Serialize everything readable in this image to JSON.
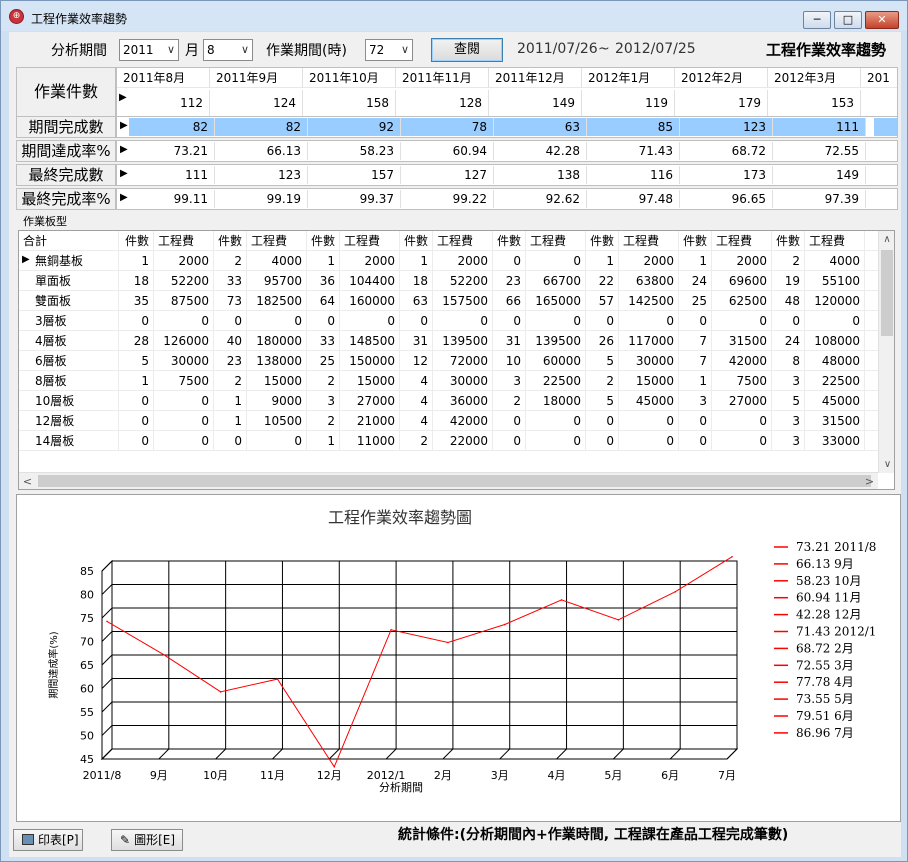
{
  "window": {
    "title": "工程作業效率趨勢",
    "minimize": "─",
    "maximize": "□",
    "close": "✕"
  },
  "filter": {
    "period_label": "分析期間",
    "year": "2011",
    "month_label": "月",
    "month": "8",
    "hours_label": "作業期間(時)",
    "hours": "72",
    "query_button": "查閱",
    "date_from": "2011/07/26",
    "date_sep": "~",
    "date_to": "2012/07/25",
    "report_title": "工程作業效率趨勢"
  },
  "summary": {
    "months": [
      "2011年8月",
      "2011年9月",
      "2011年10月",
      "2011年11月",
      "2011年12月",
      "2012年1月",
      "2012年2月",
      "2012年3月",
      "201"
    ],
    "rows": [
      {
        "label": "作業件數",
        "values": [
          "112",
          "124",
          "158",
          "128",
          "149",
          "119",
          "179",
          "153"
        ]
      },
      {
        "label": "期間完成數",
        "values": [
          "82",
          "82",
          "92",
          "78",
          "63",
          "85",
          "123",
          "111"
        ]
      },
      {
        "label": "期間達成率%",
        "values": [
          "73.21",
          "66.13",
          "58.23",
          "60.94",
          "42.28",
          "71.43",
          "68.72",
          "72.55"
        ]
      },
      {
        "label": "最終完成數",
        "values": [
          "111",
          "123",
          "157",
          "127",
          "138",
          "116",
          "173",
          "149"
        ]
      },
      {
        "label": "最終完成率%",
        "values": [
          "99.11",
          "99.19",
          "99.37",
          "99.22",
          "92.62",
          "97.48",
          "96.65",
          "97.39"
        ]
      }
    ],
    "section_label": "作業板型"
  },
  "detail": {
    "headers": [
      "合計",
      "件數",
      "工程費",
      "件數",
      "工程費",
      "件數",
      "工程費",
      "件數",
      "工程費",
      "件數",
      "工程費",
      "件數",
      "工程費",
      "件數",
      "工程費",
      "件數",
      "工程費"
    ],
    "rows": [
      [
        "無銅基板",
        "1",
        "2000",
        "2",
        "4000",
        "1",
        "2000",
        "1",
        "2000",
        "0",
        "0",
        "1",
        "2000",
        "1",
        "2000",
        "2",
        "4000"
      ],
      [
        "單面板",
        "18",
        "52200",
        "33",
        "95700",
        "36",
        "104400",
        "18",
        "52200",
        "23",
        "66700",
        "22",
        "63800",
        "24",
        "69600",
        "19",
        "55100"
      ],
      [
        "雙面板",
        "35",
        "87500",
        "73",
        "182500",
        "64",
        "160000",
        "63",
        "157500",
        "66",
        "165000",
        "57",
        "142500",
        "25",
        "62500",
        "48",
        "120000"
      ],
      [
        "3層板",
        "0",
        "0",
        "0",
        "0",
        "0",
        "0",
        "0",
        "0",
        "0",
        "0",
        "0",
        "0",
        "0",
        "0",
        "0",
        "0"
      ],
      [
        "4層板",
        "28",
        "126000",
        "40",
        "180000",
        "33",
        "148500",
        "31",
        "139500",
        "31",
        "139500",
        "26",
        "117000",
        "7",
        "31500",
        "24",
        "108000"
      ],
      [
        "6層板",
        "5",
        "30000",
        "23",
        "138000",
        "25",
        "150000",
        "12",
        "72000",
        "10",
        "60000",
        "5",
        "30000",
        "7",
        "42000",
        "8",
        "48000"
      ],
      [
        "8層板",
        "1",
        "7500",
        "2",
        "15000",
        "2",
        "15000",
        "4",
        "30000",
        "3",
        "22500",
        "2",
        "15000",
        "1",
        "7500",
        "3",
        "22500"
      ],
      [
        "10層板",
        "0",
        "0",
        "1",
        "9000",
        "3",
        "27000",
        "4",
        "36000",
        "2",
        "18000",
        "5",
        "45000",
        "3",
        "27000",
        "5",
        "45000"
      ],
      [
        "12層板",
        "0",
        "0",
        "1",
        "10500",
        "2",
        "21000",
        "4",
        "42000",
        "0",
        "0",
        "0",
        "0",
        "0",
        "0",
        "3",
        "31500"
      ],
      [
        "14層板",
        "0",
        "0",
        "0",
        "0",
        "1",
        "11000",
        "2",
        "22000",
        "0",
        "0",
        "0",
        "0",
        "0",
        "0",
        "3",
        "33000"
      ]
    ]
  },
  "chart_data": {
    "type": "line",
    "title": "工程作業效率趨勢圖",
    "xlabel": "分析期間",
    "ylabel": "期間達成率(%)",
    "categories": [
      "2011/8",
      "9月",
      "10月",
      "11月",
      "12月",
      "2012/1",
      "2月",
      "3月",
      "4月",
      "5月",
      "6月",
      "7月"
    ],
    "series": [
      {
        "values": [
          73.21,
          66.13,
          58.23,
          60.94,
          42.28,
          71.43,
          68.72,
          72.55,
          77.78,
          73.55,
          79.51,
          86.96
        ]
      }
    ],
    "ylim": [
      45,
      85
    ],
    "yticks": [
      45,
      50,
      55,
      60,
      65,
      70,
      75,
      80,
      85
    ],
    "legend": [
      "73.21 2011/8",
      "66.13 9月",
      "58.23 10月",
      "60.94 11月",
      "42.28 12月",
      "71.43 2012/1",
      "68.72 2月",
      "72.55 3月",
      "77.78 4月",
      "73.55 5月",
      "79.51 6月",
      "86.96 7月"
    ],
    "legend_position": "right",
    "grid": true,
    "line_color": "#ff0000"
  },
  "footer": {
    "print_button": "印表[P]",
    "graph_button": "圖形[E]",
    "condition": "統計條件:(分析期間內+作業時間, 工程課在產品工程完成筆數)"
  }
}
